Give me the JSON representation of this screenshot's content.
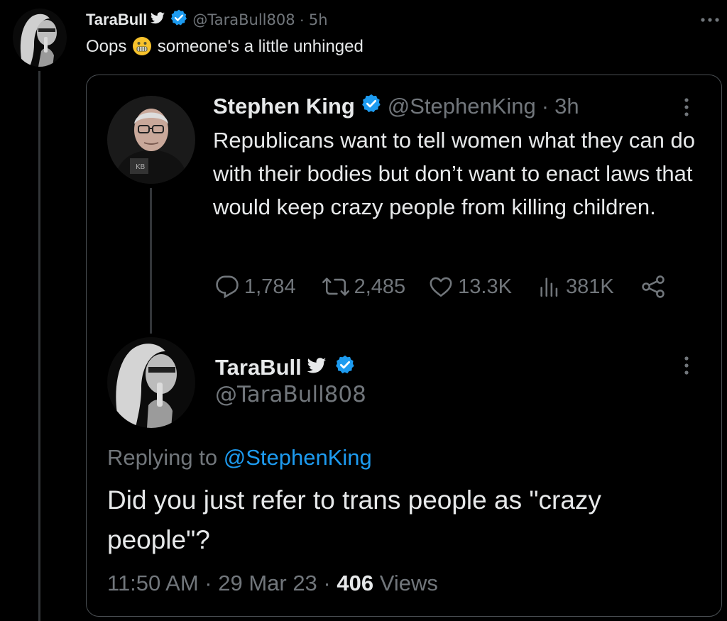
{
  "outer_tweet": {
    "author_name": "TaraBull",
    "handle": "@TaraBull808",
    "separator": "·",
    "time": "5h",
    "text_before_emoji": "Oops",
    "emoji": "grimacing-face-emoji",
    "text_after_emoji": "someone's a little unhinged",
    "more_icon": "more-horizontal-icon"
  },
  "quoted_tweet": {
    "author_name": "Stephen King",
    "handle": "@StephenKing",
    "separator": "·",
    "time": "3h",
    "text": "Republicans want to tell women what they can do with their bodies but don’t want to enact laws that would keep crazy people from killing children.",
    "metrics": {
      "replies": "1,784",
      "retweets": "2,485",
      "likes": "13.3K",
      "views": "381K"
    }
  },
  "reply_tweet": {
    "author_name": "TaraBull",
    "handle": "@TaraBull808",
    "replying_prefix": "Replying to",
    "replying_handle": "@StephenKing",
    "text": "Did you just refer to trans people as \"crazy people\"?",
    "timestamp": "11:50 AM · 29 Mar 23 ·",
    "views_count": "406",
    "views_label": "Views"
  },
  "colors": {
    "background": "#000000",
    "text": "#e7e9ea",
    "muted": "#71767b",
    "accent": "#1d9bf0"
  }
}
